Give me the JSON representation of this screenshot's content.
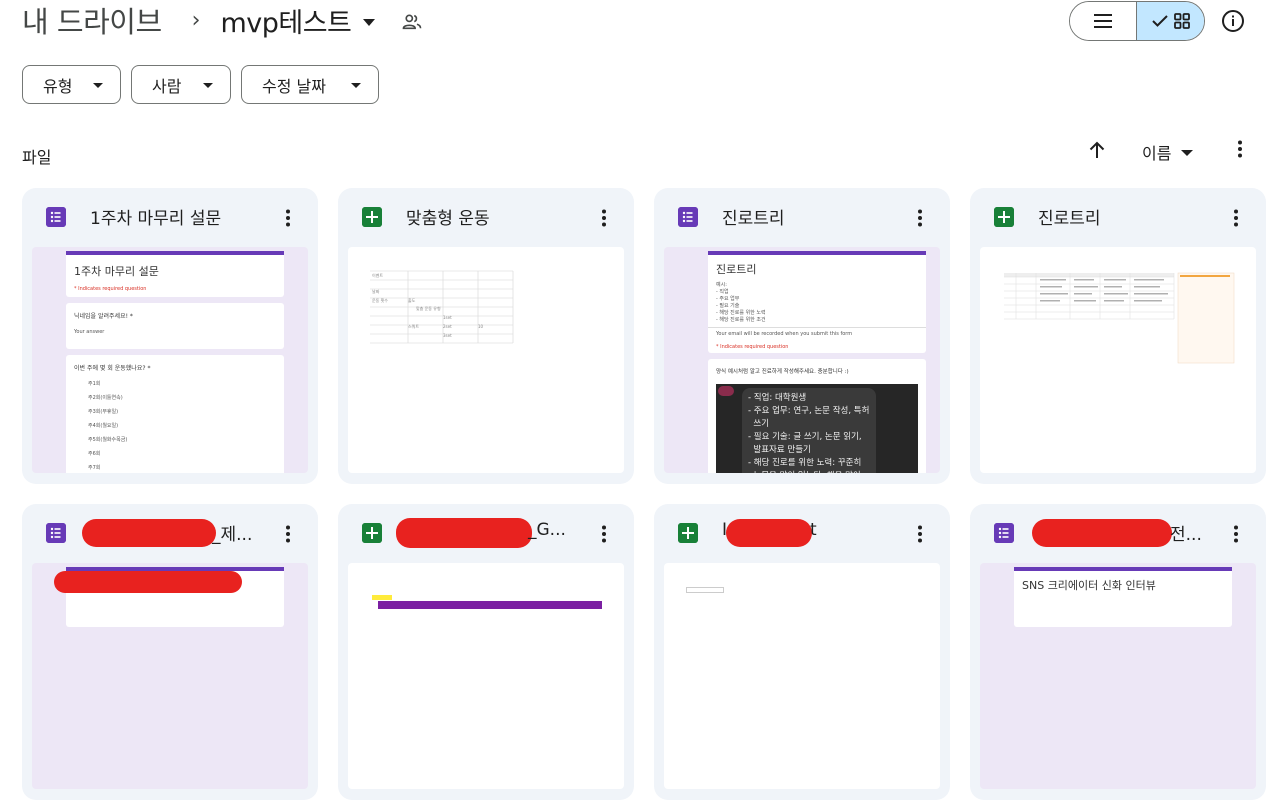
{
  "breadcrumb": {
    "root": "내 드라이브",
    "separator": "›",
    "current": "mvp테스트"
  },
  "filters": [
    {
      "label": "유형"
    },
    {
      "label": "사람"
    },
    {
      "label": "수정 날짜"
    }
  ],
  "section": {
    "label": "파일",
    "sort_label": "이름"
  },
  "icons": {
    "shared": "people-icon",
    "list_view": "list-view-icon",
    "grid_view": "grid-view-icon",
    "check": "check-icon",
    "info": "info-icon",
    "arrow_up": "arrow-up-icon",
    "more": "more-vert-icon",
    "form": "google-forms-icon",
    "sheet": "google-sheets-icon"
  },
  "colors": {
    "form": "#673ab7",
    "sheet": "#188038",
    "selected_view": "#c2e7ff",
    "card_bg": "#f0f4f9",
    "redaction": "#e8221f"
  },
  "cards": [
    {
      "title": "1주차 마무리 설문",
      "type": "form",
      "thumb": {
        "heading": "1주차 마무리 설문",
        "required_note": "* Indicates required question",
        "q1": "닉네임을 알려주세요! *",
        "q1_hint": "Your answer",
        "q2": "이번 주에 몇 회 운동했나요? *",
        "options": [
          "주1회",
          "주2회(이틀연속)",
          "주3회(무휴일)",
          "주4회(월요일)",
          "주5회(월화수목금)",
          "주6회",
          "주7회"
        ]
      }
    },
    {
      "title": "맞춤형 운동",
      "type": "sheet"
    },
    {
      "title": "진로트리",
      "type": "form",
      "thumb": {
        "heading": "진로트리",
        "lines": [
          "예시:",
          "- 직업",
          "- 주요 업무",
          "- 필요 기술",
          "- 해당 진로를 위한 노력",
          "- 해당 진로를 위한 조건"
        ],
        "email_note": "Your email will be recorded when you submit this form",
        "required_note": "* Indicates required question",
        "prompt": "양식 예시처럼 알고 진료하게 작성해주세요. 충분합니다 :)",
        "chat": "- 직업: 대학원생\n- 주요 업무: 연구, 논문 작성, 특허\n  쓰기\n- 필요 기술: 글 쓰기, 논문 읽기,\n  발표자료 만들기\n- 해당 진로를 위한 노력: 꾸준히\n  논문을 많이 읽는다. 책을 많이"
      }
    },
    {
      "title": "진로트리",
      "type": "sheet"
    },
    {
      "title_suffix": "_제...",
      "type": "form"
    },
    {
      "title_suffix": "_G...",
      "type": "sheet"
    },
    {
      "title_prefix": "I",
      "title_suffix": "t",
      "type": "sheet"
    },
    {
      "title_suffix": "전...",
      "type": "form",
      "thumb": {
        "heading": "SNS 크리에이터 신화 인터뷰"
      }
    }
  ]
}
